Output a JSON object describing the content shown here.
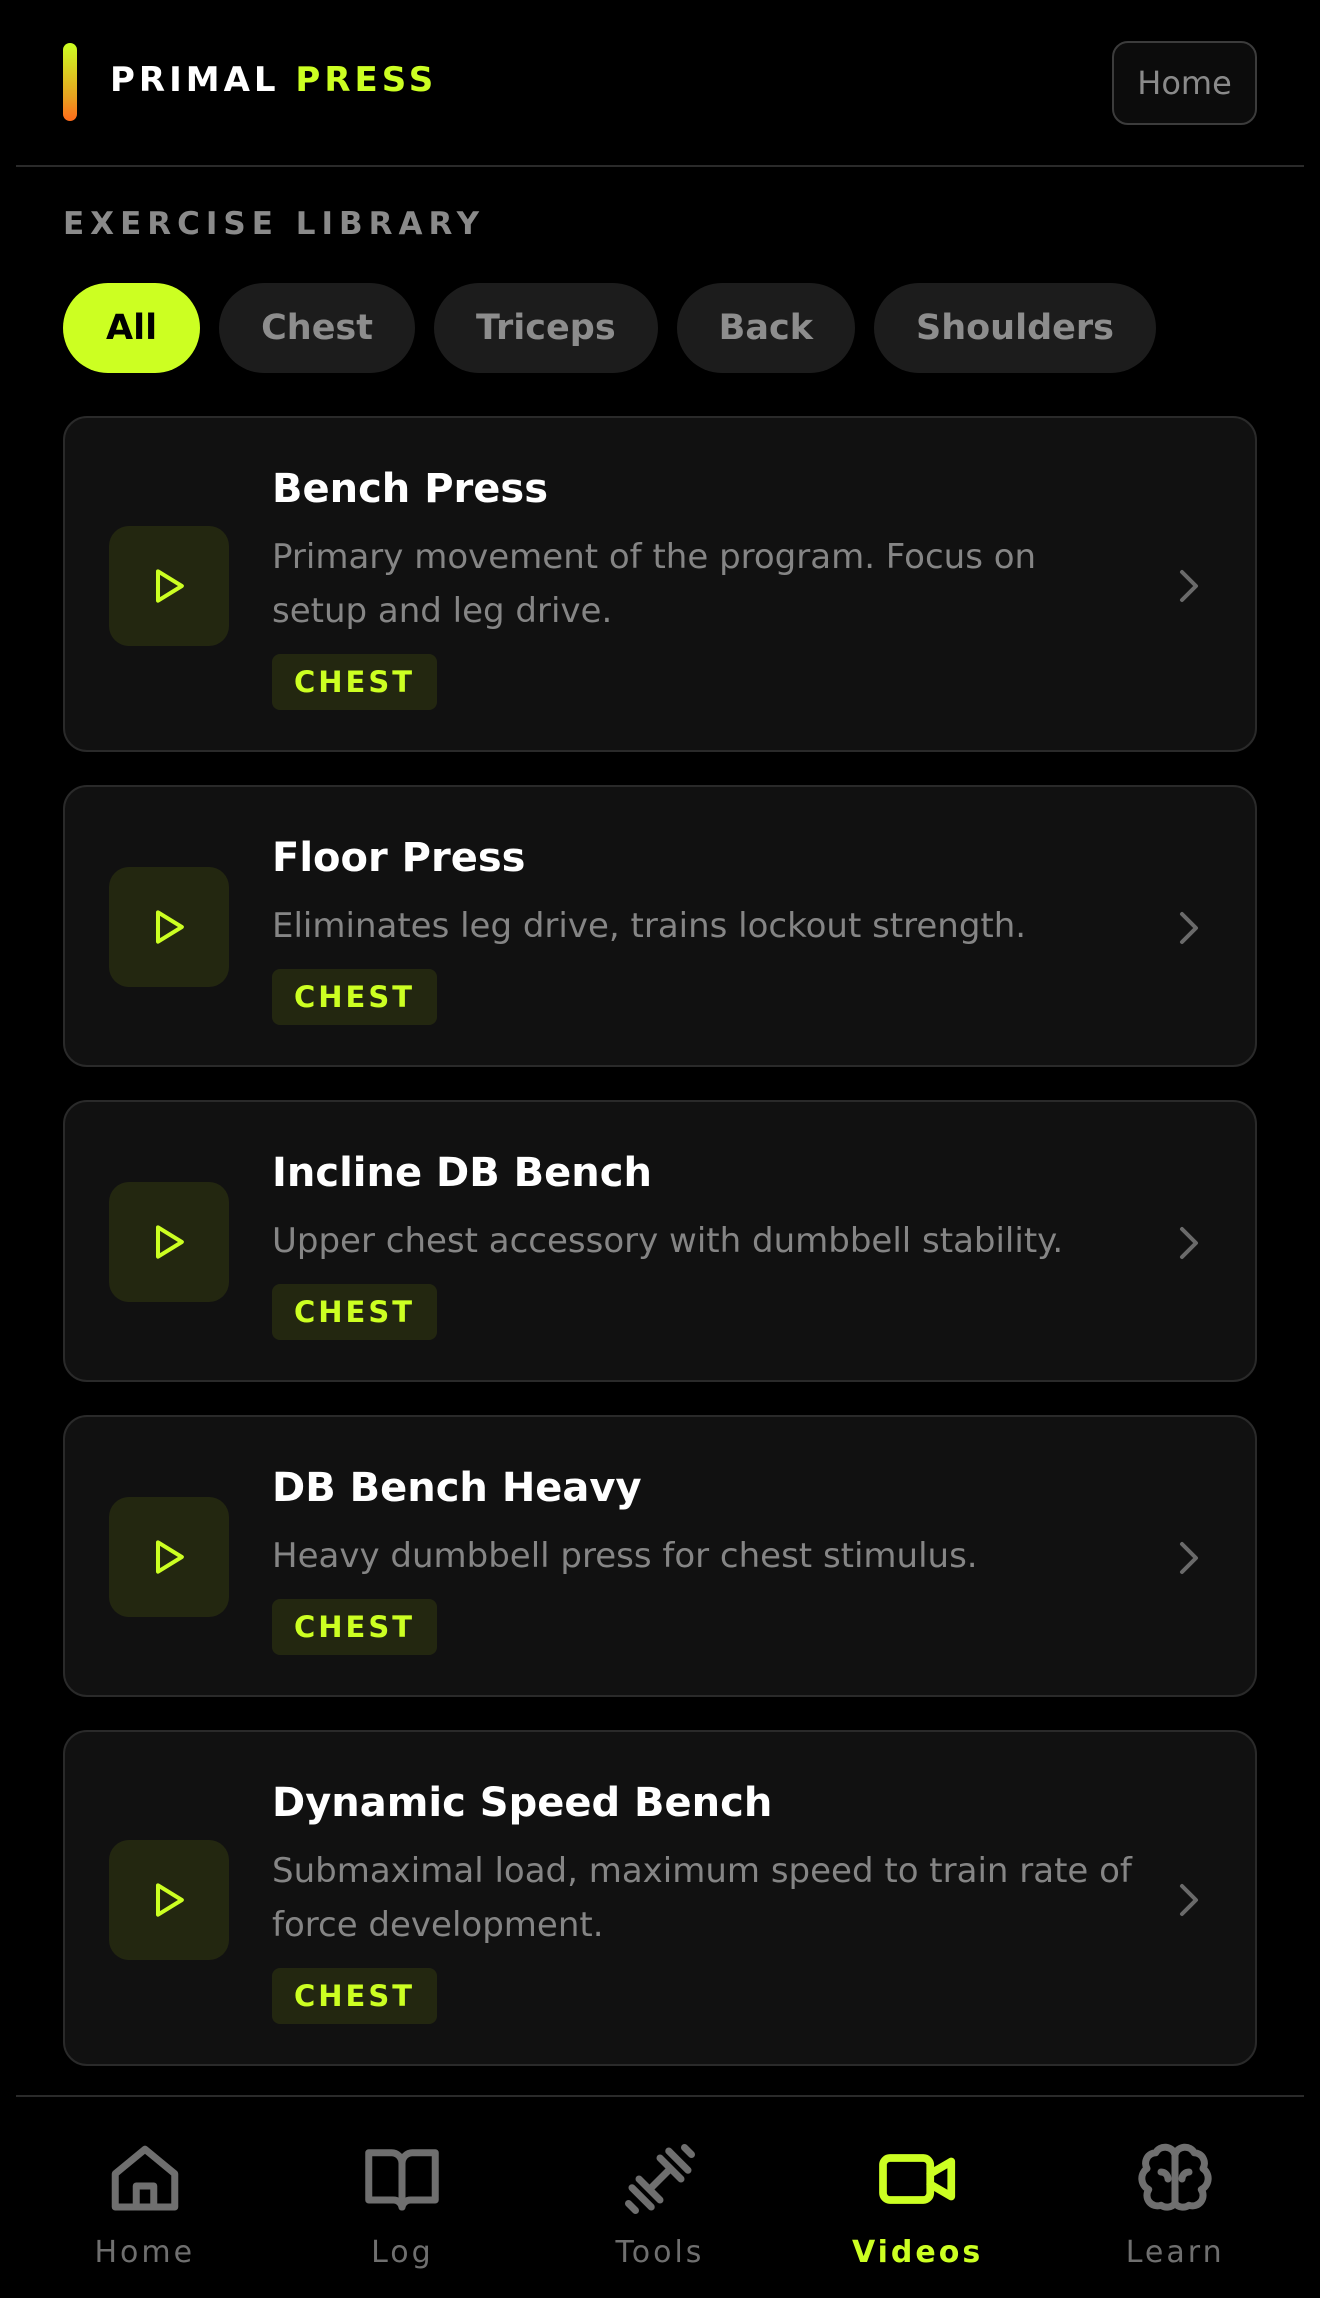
{
  "header": {
    "brand_primary": "PRIMAL",
    "brand_accent": "PRESS",
    "home_button": "Home"
  },
  "library": {
    "section_label": "EXERCISE LIBRARY",
    "filters": [
      "All",
      "Chest",
      "Triceps",
      "Back",
      "Shoulders"
    ],
    "active_filter": "All"
  },
  "exercises": [
    {
      "title": "Bench Press",
      "description": "Primary movement of the program. Focus on setup and leg drive.",
      "tag": "CHEST"
    },
    {
      "title": "Floor Press",
      "description": "Eliminates leg drive, trains lockout strength.",
      "tag": "CHEST"
    },
    {
      "title": "Incline DB Bench",
      "description": "Upper chest accessory with dumbbell stability.",
      "tag": "CHEST"
    },
    {
      "title": "DB Bench Heavy",
      "description": "Heavy dumbbell press for chest stimulus.",
      "tag": "CHEST"
    },
    {
      "title": "Dynamic Speed Bench",
      "description": "Submaximal load, maximum speed to train rate of force development.",
      "tag": "CHEST"
    }
  ],
  "nav": {
    "items": [
      {
        "label": "Home",
        "icon": "home-icon"
      },
      {
        "label": "Log",
        "icon": "book-icon"
      },
      {
        "label": "Tools",
        "icon": "dumbbell-icon"
      },
      {
        "label": "Videos",
        "icon": "video-camera-icon"
      },
      {
        "label": "Learn",
        "icon": "brain-icon"
      }
    ],
    "active": "Videos"
  },
  "colors": {
    "accent": "#ccff22",
    "background": "#000000",
    "card": "#111111",
    "muted_text": "#858585"
  }
}
